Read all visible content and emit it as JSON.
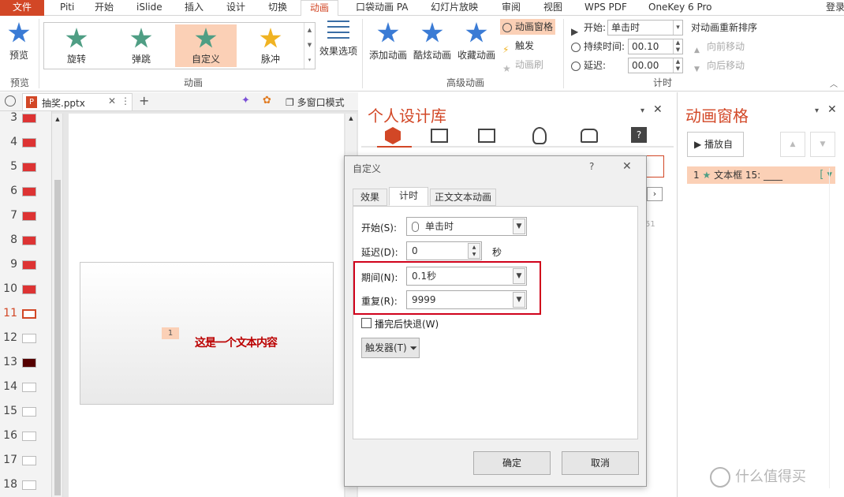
{
  "menu": {
    "file": "文件",
    "tabs": [
      "Piti",
      "开始",
      "iSlide",
      "插入",
      "设计",
      "切换",
      "动画",
      "口袋动画 PA",
      "幻灯片放映",
      "审阅",
      "视图",
      "WPS PDF",
      "OneKey 6 Pro"
    ],
    "active": "动画",
    "login": "登录"
  },
  "ribbon": {
    "preview": {
      "label": "预览",
      "group": "预览"
    },
    "animations": {
      "items": [
        "旋转",
        "弹跳",
        "自定义",
        "脉冲"
      ],
      "selected": "自定义",
      "effect_options": "效果选项",
      "group": "动画"
    },
    "advanced": {
      "add": "添加动画",
      "cool": "酷炫动画",
      "collect": "收藏动画",
      "pane": "动画窗格",
      "trigger": "触发",
      "painter": "动画刷",
      "group": "高级动画"
    },
    "timing": {
      "start_label": "开始:",
      "start_value": "单击时",
      "duration_label": "持续时间:",
      "duration_value": "00.10",
      "delay_label": "延迟:",
      "delay_value": "00.00",
      "reorder": "对动画重新排序",
      "move_earlier": "向前移动",
      "move_later": "向后移动",
      "group": "计时"
    }
  },
  "doc_tab": {
    "name": "抽奖.pptx",
    "multi_window": "多窗口模式"
  },
  "thumbnails": [
    "3",
    "4",
    "5",
    "6",
    "7",
    "8",
    "9",
    "10",
    "11",
    "12",
    "13",
    "14",
    "15",
    "16",
    "17",
    "18"
  ],
  "current_slide": "11",
  "slide": {
    "badge": "1",
    "text": "这是一个文本内容"
  },
  "library": {
    "title": "个人设计库",
    "side_number": "51"
  },
  "anim_pane": {
    "title": "动画窗格",
    "play": "播放自",
    "item_number": "1",
    "item_label": "文本框 15: ____"
  },
  "dialog": {
    "title": "自定义",
    "help": "?",
    "tabs": [
      "效果",
      "计时",
      "正文文本动画"
    ],
    "active_tab": "计时",
    "start_label": "开始(S):",
    "start_value": "单击时",
    "delay_label": "延迟(D):",
    "delay_value": "0",
    "delay_unit": "秒",
    "period_label": "期间(N):",
    "period_value": "0.1秒",
    "repeat_label": "重复(R):",
    "repeat_value": "9999",
    "rewind_label": "播完后快退(W)",
    "trigger_label": "触发器(T)",
    "ok": "确定",
    "cancel": "取消"
  },
  "watermark": "什么值得买",
  "colors": {
    "accent": "#d24726",
    "highlight_box": "#d0021b",
    "selected": "#fbd0b6",
    "star_green": "#4f9e84",
    "star_blue": "#3a7bd5"
  }
}
